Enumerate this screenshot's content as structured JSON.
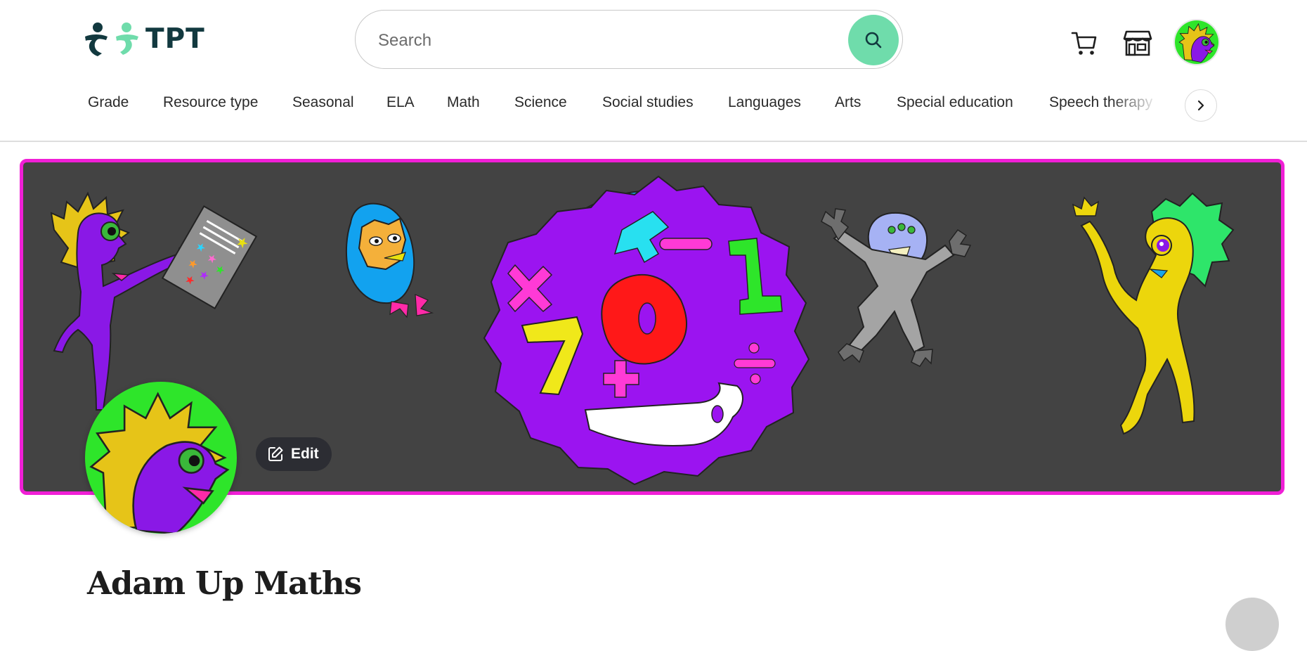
{
  "header": {
    "logo_text": "TPT",
    "search": {
      "placeholder": "Search",
      "value": ""
    },
    "icons": [
      "cart-icon",
      "store-icon",
      "profile-avatar"
    ]
  },
  "nav": {
    "items": [
      {
        "label": "Grade"
      },
      {
        "label": "Resource type"
      },
      {
        "label": "Seasonal"
      },
      {
        "label": "ELA"
      },
      {
        "label": "Math"
      },
      {
        "label": "Science"
      },
      {
        "label": "Social studies"
      },
      {
        "label": "Languages"
      },
      {
        "label": "Arts"
      },
      {
        "label": "Special education"
      },
      {
        "label": "Speech therapy"
      }
    ],
    "next_icon": "chevron-right-icon"
  },
  "banner": {
    "border_color": "#f01fd6",
    "background": "#434343",
    "edit_label": "Edit"
  },
  "store": {
    "name": "Adam Up Maths"
  },
  "colors": {
    "brand_dark": "#12393f",
    "brand_green": "#6fdcab",
    "accent_magenta": "#f01fd6"
  }
}
